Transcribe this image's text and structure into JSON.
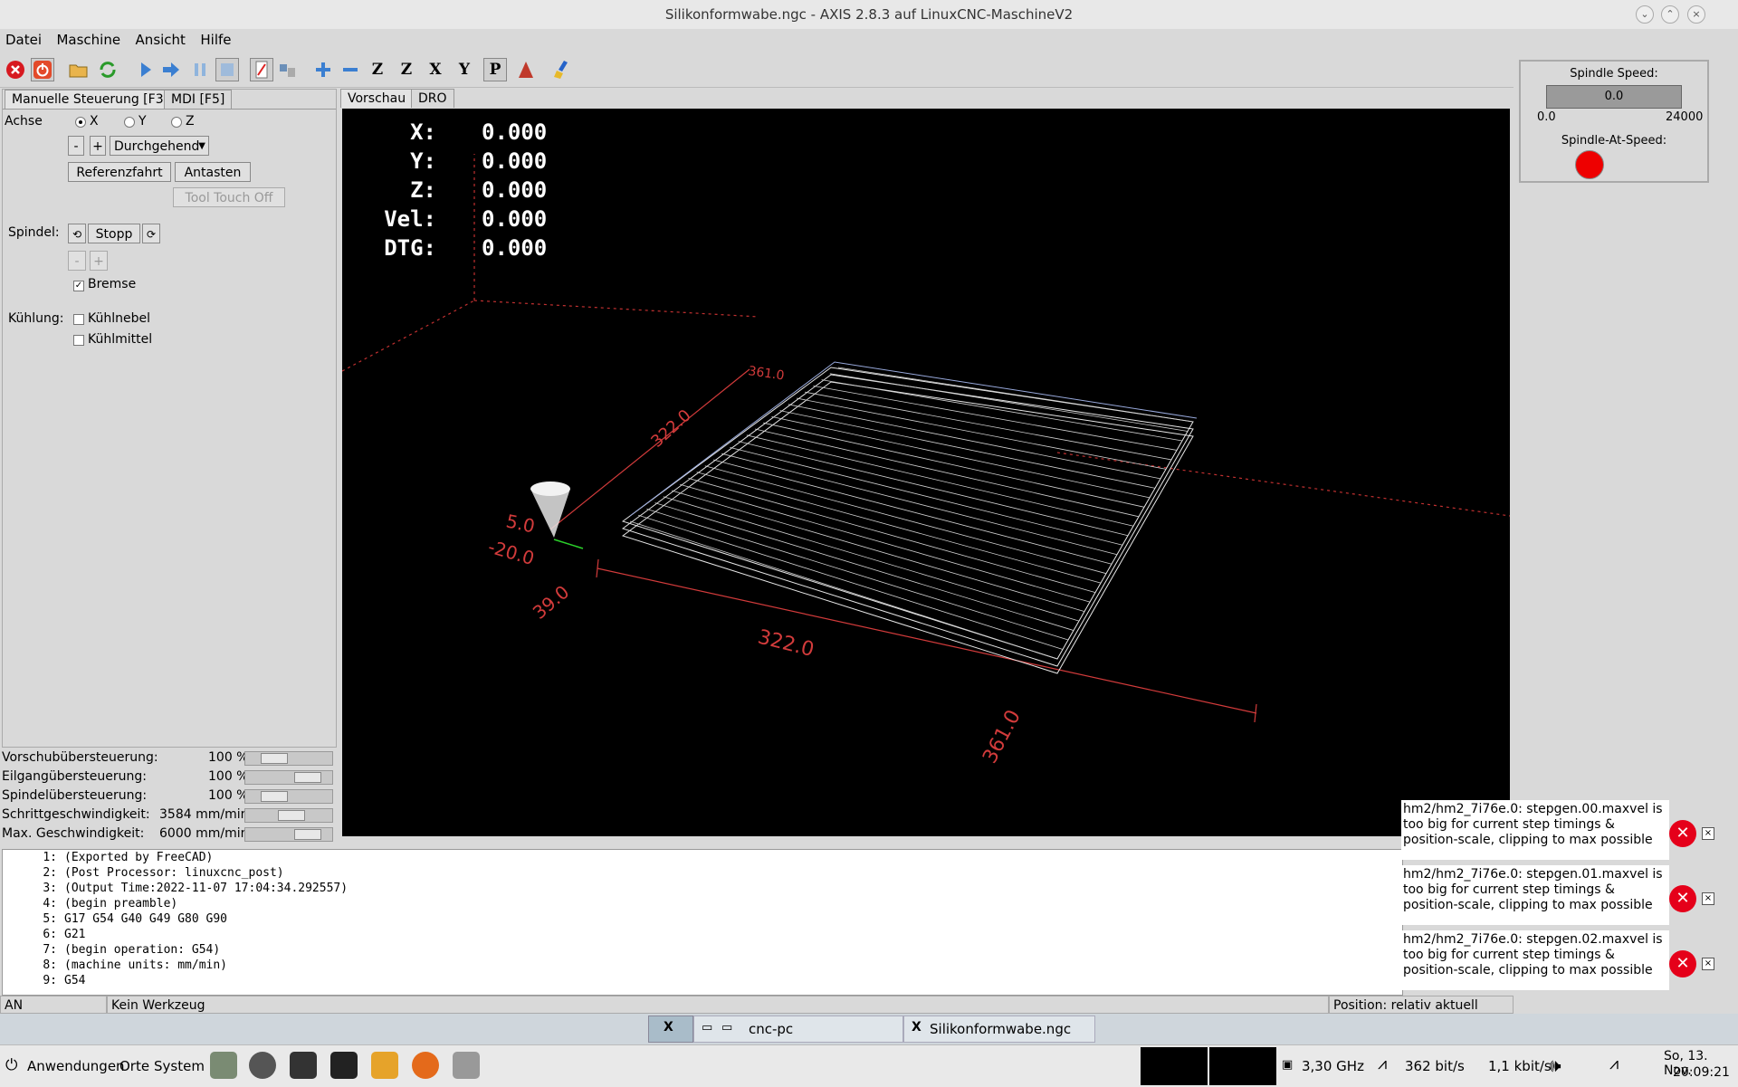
{
  "window": {
    "title": "Silikonformwabe.ngc - AXIS 2.8.3 auf LinuxCNC-MaschineV2"
  },
  "menu": [
    "Datei",
    "Maschine",
    "Ansicht",
    "Hilfe"
  ],
  "toolbar": {
    "icons": [
      "estop-icon",
      "power-icon",
      "open-icon",
      "reload-icon",
      "run-icon",
      "step-icon",
      "pause-icon",
      "stop-icon",
      "block-delete-icon",
      "optional-stop-icon",
      "zoom-in-icon",
      "zoom-out-icon",
      "view-z-icon",
      "view-z2-icon",
      "view-x-icon",
      "view-y-icon",
      "view-p-icon",
      "rotate-icon",
      "clear-backplot-icon"
    ],
    "view_labels": [
      "Z",
      "Z",
      "X",
      "Y",
      "P"
    ]
  },
  "left": {
    "tabs": [
      "Manuelle Steuerung [F3]",
      "MDI [F5]"
    ],
    "axis_label": "Achse",
    "axes": [
      "X",
      "Y",
      "Z"
    ],
    "selected_axis": "X",
    "jog_minus": "-",
    "jog_plus": "+",
    "jog_mode": "Durchgehend",
    "home_button": "Referenzfahrt",
    "touch_button": "Antasten",
    "tool_touch_off": "Tool Touch Off",
    "spindle_label": "Spindel:",
    "spindle_stop": "Stopp",
    "spindle_minus": "-",
    "spindle_plus": "+",
    "brake_label": "Bremse",
    "brake_checked": true,
    "cooling_label": "Kühlung:",
    "mist_label": "Kühlnebel",
    "flood_label": "Kühlmittel"
  },
  "overrides": [
    {
      "label": "Vorschubübersteuerung:",
      "value": "100 %",
      "level": 0.25
    },
    {
      "label": "Eilgangübersteuerung:",
      "value": "100 %",
      "level": 0.82
    },
    {
      "label": "Spindelübersteuerung:",
      "value": "100 %",
      "level": 0.25
    },
    {
      "label": "Schrittgeschwindigkeit:",
      "value": "3584 mm/min",
      "level": 0.55
    },
    {
      "label": "Max. Geschwindigkeit:",
      "value": "6000 mm/min",
      "level": 0.82
    }
  ],
  "preview": {
    "tabs": [
      "Vorschau",
      "DRO"
    ],
    "dro": [
      {
        "label": "X:",
        "value": "0.000"
      },
      {
        "label": "Y:",
        "value": "0.000"
      },
      {
        "label": "Z:",
        "value": "0.000"
      },
      {
        "label": "Vel:",
        "value": "0.000"
      },
      {
        "label": "DTG:",
        "value": "0.000"
      }
    ],
    "dims": [
      "361.0",
      "322.0",
      "322.0",
      "361.0",
      "39.0",
      "5.0",
      "-20.0"
    ]
  },
  "spindle_panel": {
    "speed_label": "Spindle Speed:",
    "speed_value": "0.0",
    "min": "0.0",
    "max": "24000",
    "at_speed_label": "Spindle-At-Speed:",
    "at_speed_color": "#ee0000"
  },
  "gcode": [
    {
      "n": "1:",
      "text": "(Exported by FreeCAD)"
    },
    {
      "n": "2:",
      "text": "(Post Processor: linuxcnc_post)"
    },
    {
      "n": "3:",
      "text": "(Output Time:2022-11-07 17:04:34.292557)"
    },
    {
      "n": "4:",
      "text": "(begin preamble)"
    },
    {
      "n": "5:",
      "text": "G17 G54 G40 G49 G80 G90"
    },
    {
      "n": "6:",
      "text": "G21"
    },
    {
      "n": "7:",
      "text": "(begin operation: G54)"
    },
    {
      "n": "8:",
      "text": "(machine units: mm/min)"
    },
    {
      "n": "9:",
      "text": "G54"
    }
  ],
  "notifications": [
    "hm2/hm2_7i76e.0: stepgen.00.maxvel is too big for current step timings & position-scale, clipping to max possible",
    "hm2/hm2_7i76e.0: stepgen.01.maxvel is too big for current step timings & position-scale, clipping to max possible",
    "hm2/hm2_7i76e.0: stepgen.02.maxvel is too big for current step timings & position-scale, clipping to max possible"
  ],
  "status": {
    "state": "AN",
    "tool": "Kein Werkzeug",
    "position": "Position: relativ aktuell"
  },
  "taskstrip": {
    "item1": "cnc-pc",
    "item2": "Silikonformwabe.ngc"
  },
  "panel": {
    "menus": [
      "Anwendungen",
      "Orte",
      "System"
    ],
    "cpu": "3,30 GHz",
    "net_down": "362 bit/s",
    "net_up": "1,1 kbit/s",
    "date": "So, 13. Nov.",
    "time": "20:09:21"
  }
}
